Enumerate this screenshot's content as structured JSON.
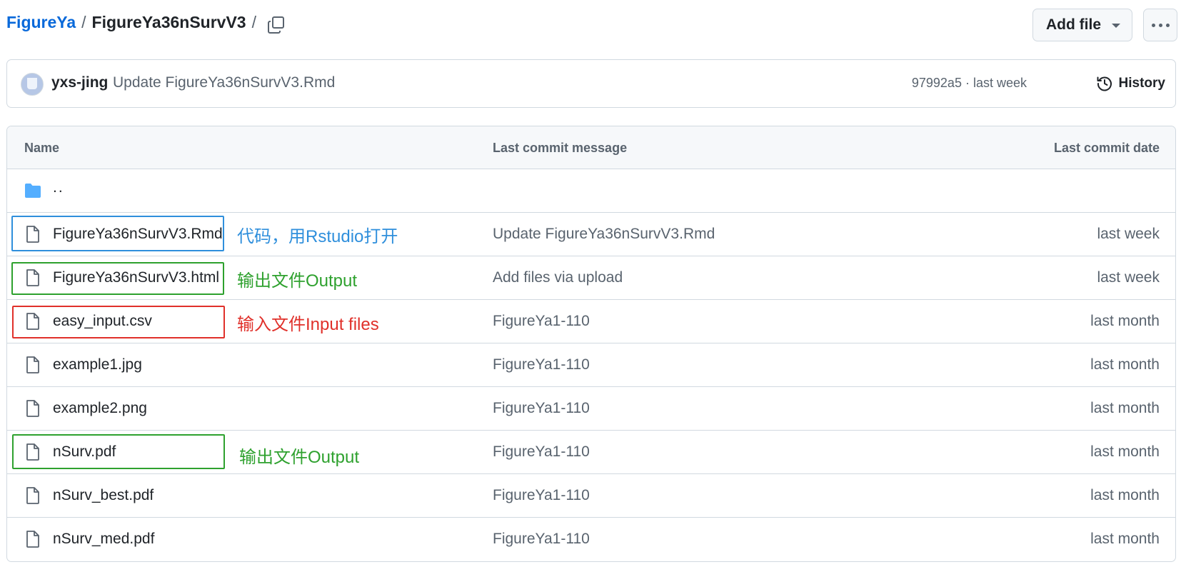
{
  "breadcrumb": {
    "repo": "FigureYa",
    "separator": "/",
    "directory": "FigureYa36nSurvV3",
    "trailing_separator": "/"
  },
  "toolbar": {
    "add_file_label": "Add file",
    "copy_icon": "copy-icon",
    "more_icon": "kebab-horizontal-icon"
  },
  "latest_commit": {
    "author": "yxs-jing",
    "message": "Update FigureYa36nSurvV3.Rmd",
    "sha": "97992a5",
    "meta_separator": " · ",
    "time": "last week",
    "history_label": "History"
  },
  "table": {
    "headers": {
      "name": "Name",
      "message": "Last commit message",
      "date": "Last commit date"
    },
    "parent_dir_label": "..",
    "rows": [
      {
        "name": "FigureYa36nSurvV3.Rmd",
        "message": "Update FigureYa36nSurvV3.Rmd",
        "date": "last week"
      },
      {
        "name": "FigureYa36nSurvV3.html",
        "message": "Add files via upload",
        "date": "last week"
      },
      {
        "name": "easy_input.csv",
        "message": "FigureYa1-110",
        "date": "last month"
      },
      {
        "name": "example1.jpg",
        "message": "FigureYa1-110",
        "date": "last month"
      },
      {
        "name": "example2.png",
        "message": "FigureYa1-110",
        "date": "last month"
      },
      {
        "name": "nSurv.pdf",
        "message": "FigureYa1-110",
        "date": "last month"
      },
      {
        "name": "nSurv_best.pdf",
        "message": "FigureYa1-110",
        "date": "last month"
      },
      {
        "name": "nSurv_med.pdf",
        "message": "FigureYa1-110",
        "date": "last month"
      }
    ]
  },
  "annotations": [
    {
      "text": "代码，用Rstudio打开",
      "color": "#2f8fdc"
    },
    {
      "text": "输出文件Output",
      "color": "#2ea12e"
    },
    {
      "text": "输入文件Input files",
      "color": "#e0302a"
    },
    {
      "text": "输出文件Output",
      "color": "#2ea12e"
    }
  ],
  "colors": {
    "link": "#0969da",
    "folder": "#54aeff",
    "muted": "#59636e",
    "border": "#d1d9e0"
  }
}
